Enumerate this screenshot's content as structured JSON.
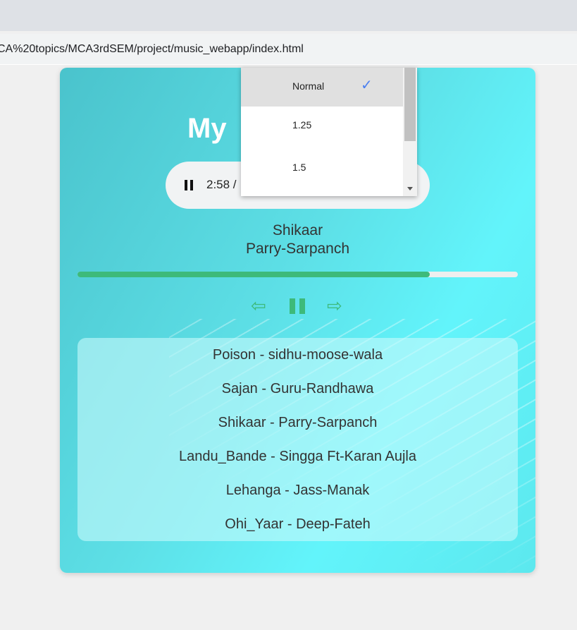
{
  "browser": {
    "url": "CA%20topics/MCA3rdSEM/project/music_webapp/index.html"
  },
  "player": {
    "title": "My",
    "audio": {
      "time": "2:58 /"
    },
    "speed_menu": {
      "options": [
        {
          "label": "Normal",
          "selected": true
        },
        {
          "label": "1.25"
        },
        {
          "label": "1.5"
        }
      ]
    },
    "now_playing": {
      "song": "Shikaar",
      "artist": "Parry-Sarpanch"
    },
    "progress_percent": 80,
    "controls": {
      "prev": "⇦",
      "next": "⇨"
    },
    "playlist": [
      "Poison - sidhu-moose-wala",
      "Sajan - Guru-Randhawa",
      "Shikaar - Parry-Sarpanch",
      "Landu_Bande - Singga Ft-Karan Aujla",
      "Lehanga - Jass-Manak",
      "Ohi_Yaar - Deep-Fateh"
    ],
    "colors": {
      "accent": "#3dba7a",
      "check": "#4a7ff0"
    }
  }
}
